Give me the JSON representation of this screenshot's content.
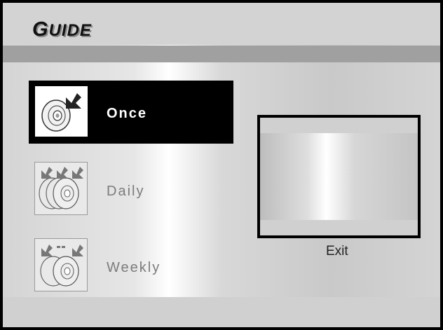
{
  "guide": {
    "title_first": "G",
    "title_rest": "UIDE"
  },
  "menu": {
    "items": [
      {
        "label": "Once",
        "icon": "single-disc-arrow-icon",
        "selected": true
      },
      {
        "label": "Daily",
        "icon": "triple-disc-arrows-icon",
        "selected": false
      },
      {
        "label": "Weekly",
        "icon": "double-disc-arrows-icon",
        "selected": false
      }
    ]
  },
  "preview": {
    "exit_label": "Exit"
  },
  "colors": {
    "selected_bg": "#000000",
    "selected_text": "#ffffff",
    "unselected_text": "#7c7c7c",
    "band": "#a0a0a0"
  }
}
